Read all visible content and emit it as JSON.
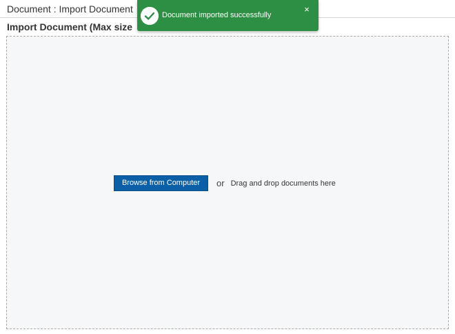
{
  "header": {
    "title": "Document : Import Document"
  },
  "section": {
    "heading": "Import Document (Max size"
  },
  "dropzone": {
    "browse_label": "Browse from Computer",
    "or_label": "or",
    "drag_label": "Drag and drop documents here"
  },
  "toast": {
    "message": "Document imported successfully",
    "close_label": "×",
    "icon": "check-circle-icon"
  },
  "colors": {
    "toast_bg": "#2d8f43",
    "button_bg": "#0a5fa6",
    "dropzone_bg": "#f6f7f9"
  }
}
